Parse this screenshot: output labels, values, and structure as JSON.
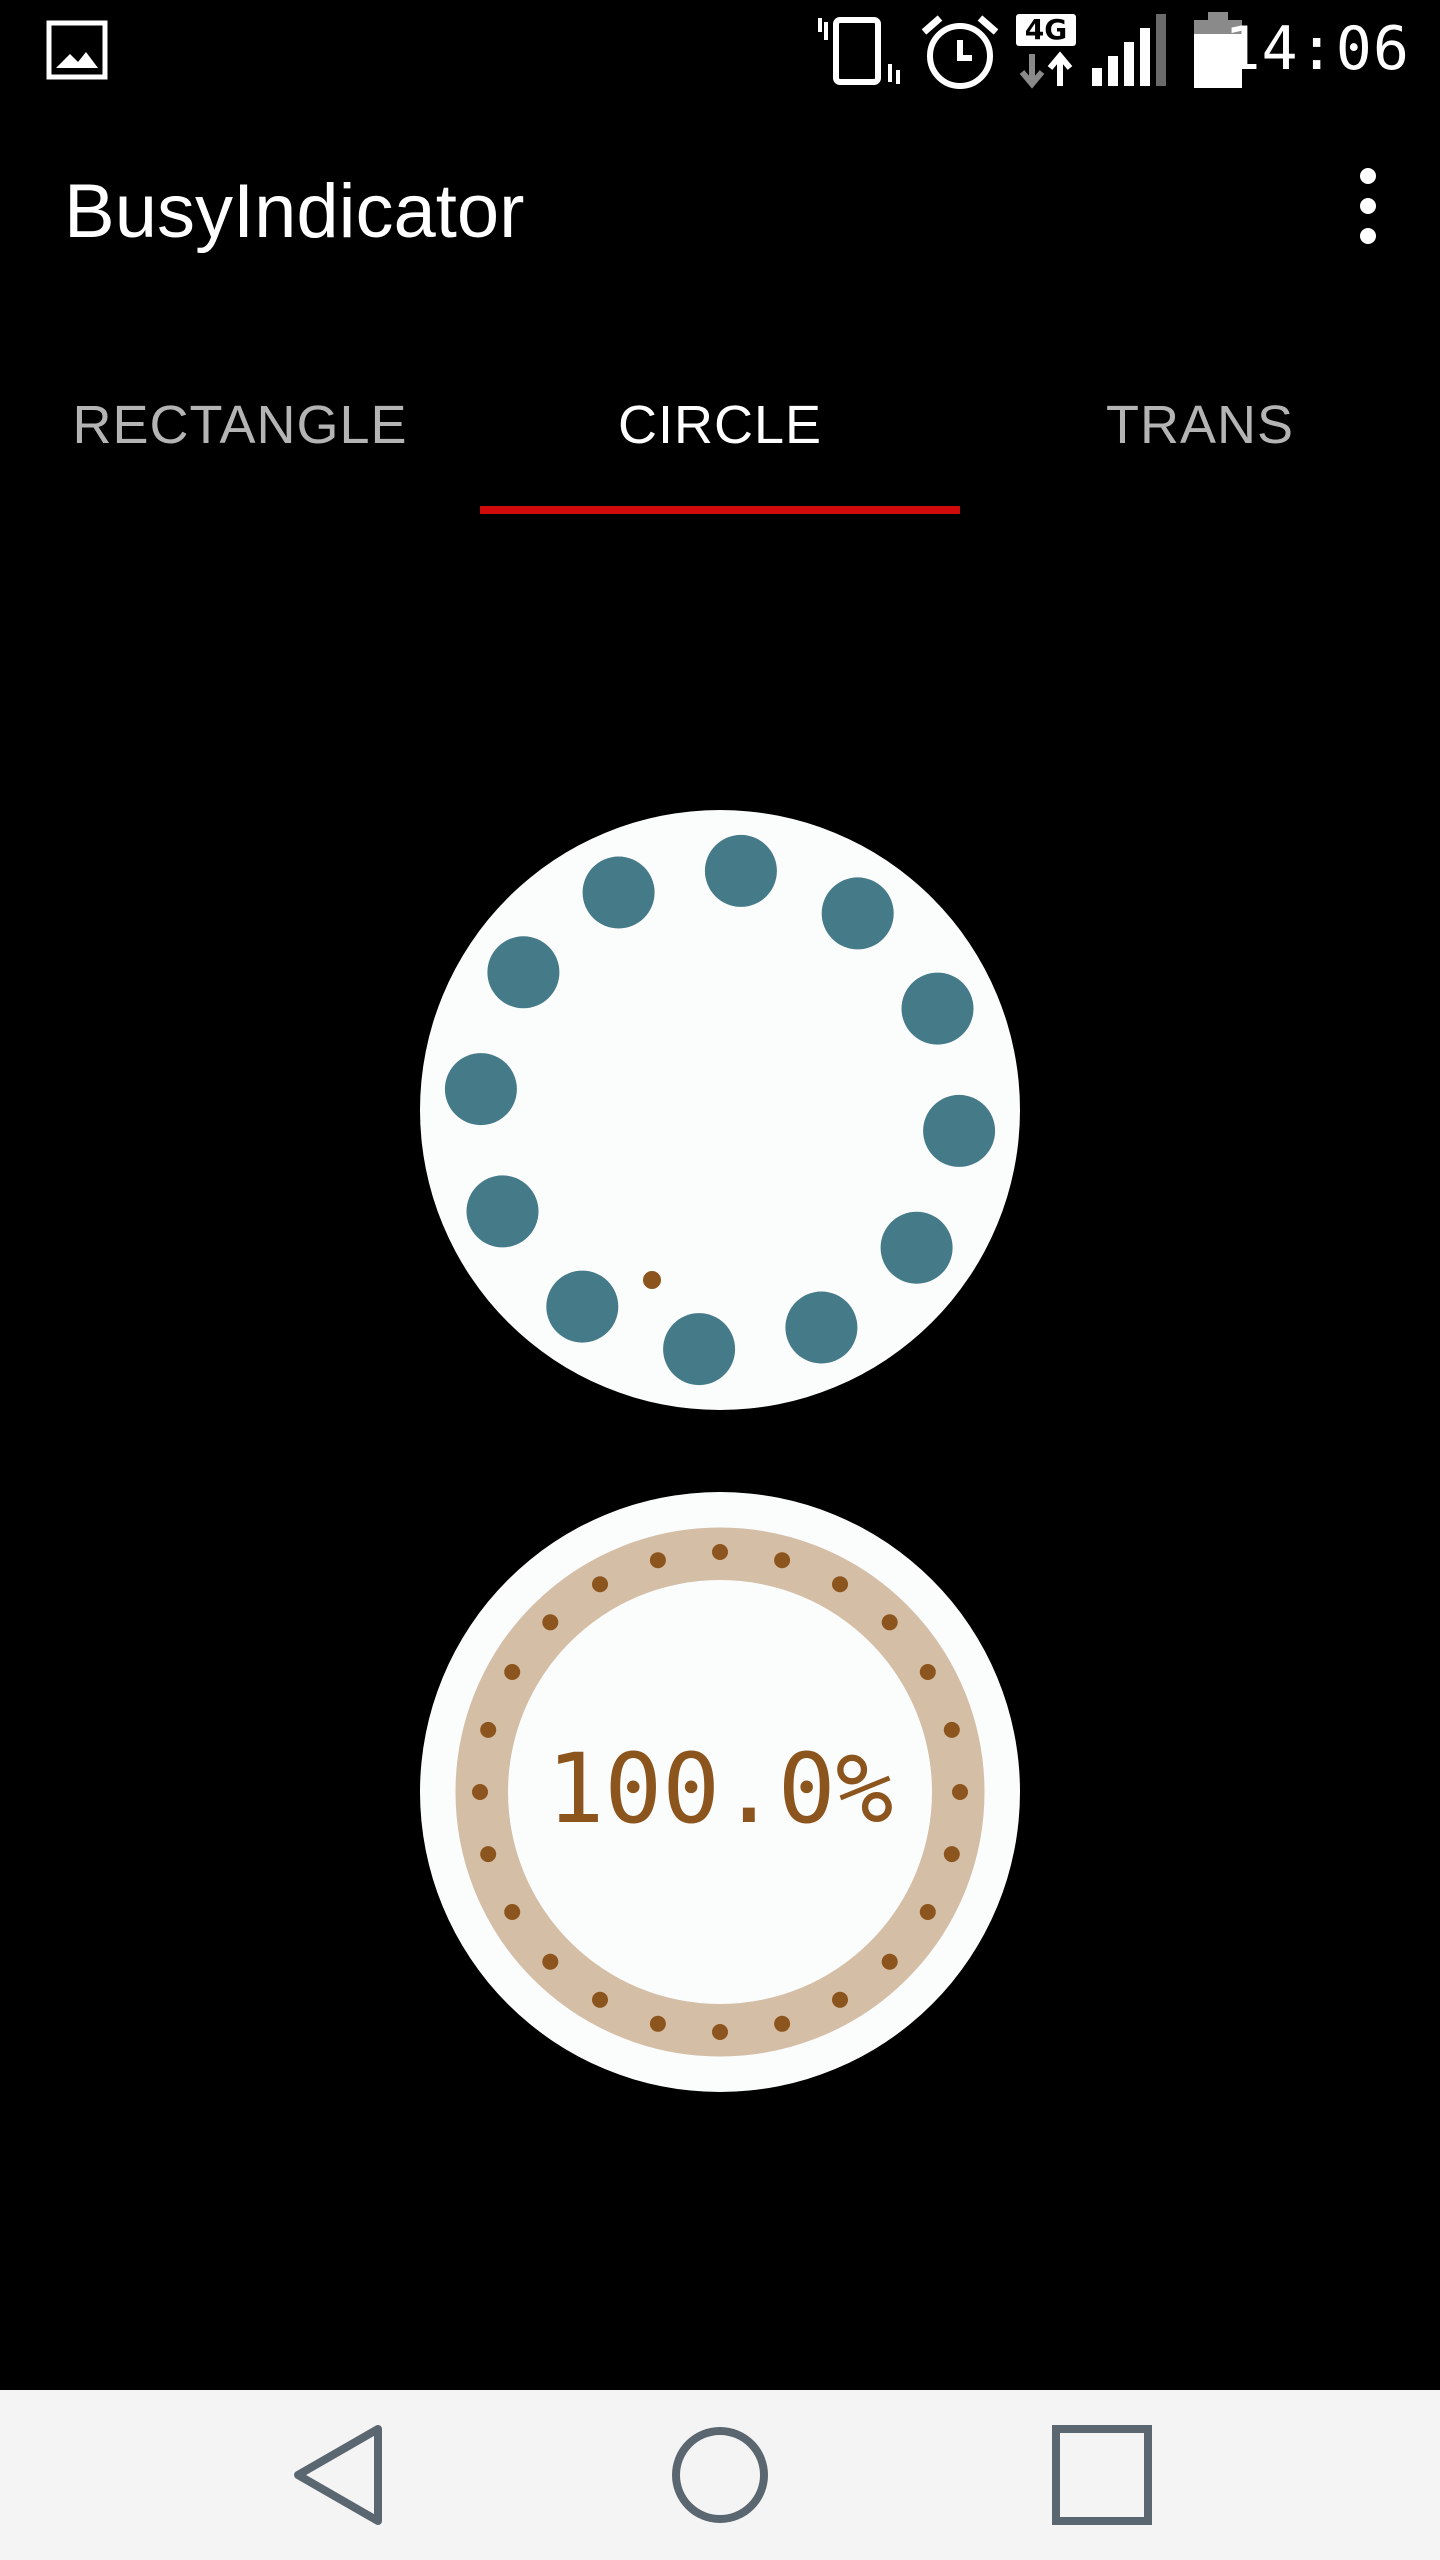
{
  "status_bar": {
    "time": "14:06",
    "network": "4G",
    "icons": [
      "gallery-icon",
      "vibrate-icon",
      "alarm-icon",
      "network-4g-icon",
      "signal-icon",
      "battery-icon"
    ]
  },
  "app_bar": {
    "title": "BusyIndicator",
    "menu_icon": "more-vert-icon"
  },
  "tabs": [
    {
      "label": "RECTANGLE",
      "active": false
    },
    {
      "label": "CIRCLE",
      "active": true
    },
    {
      "label": "TRANS",
      "active": false
    }
  ],
  "colors": {
    "background": "#000000",
    "tab_indicator": "#d10a0a",
    "indicator_dot": "#457a89",
    "indicator_bg": "#fbfcfc",
    "progress_ring": "#d4bea6",
    "progress_dot": "#8c551e",
    "progress_text": "#8c551e",
    "nav_bar": "#f4f4f4",
    "nav_icon": "#5a6670"
  },
  "busy_indicator": {
    "type": "circle",
    "dot_count": 12
  },
  "progress_indicator": {
    "label": "100.0%",
    "progress": 1.0,
    "dot_count": 24
  },
  "nav_bar": {
    "buttons": [
      "back-icon",
      "home-icon",
      "recents-icon"
    ]
  }
}
